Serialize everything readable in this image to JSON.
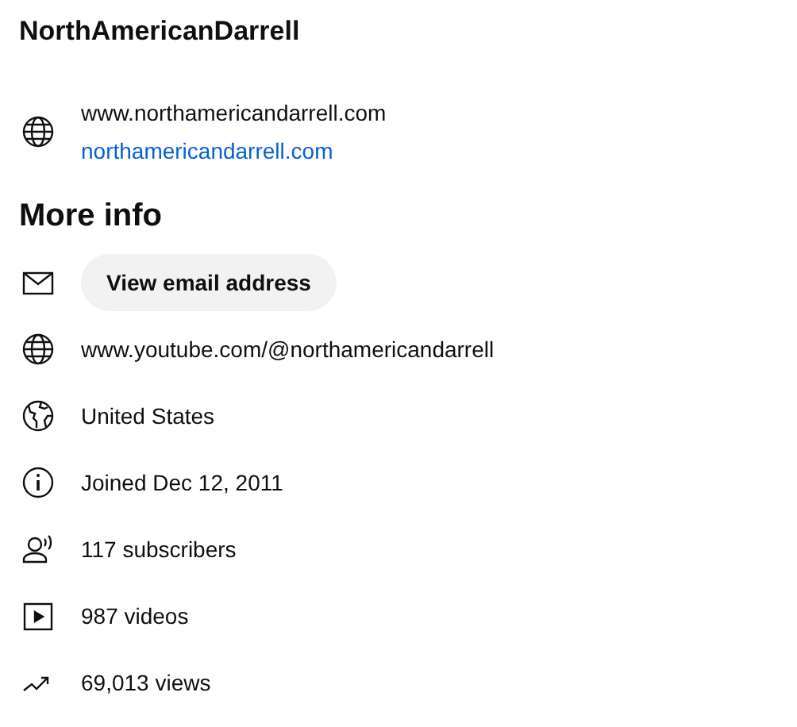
{
  "channel_name": "NorthAmericanDarrell",
  "link": {
    "title": "www.northamericandarrell.com",
    "url": "northamericandarrell.com"
  },
  "more_info": {
    "heading": "More info",
    "items": [
      {
        "kind": "email",
        "label": "View email address"
      },
      {
        "kind": "website",
        "label": "www.youtube.com/@northamericandarrell"
      },
      {
        "kind": "country",
        "label": "United States"
      },
      {
        "kind": "joined",
        "label": "Joined Dec 12, 2011"
      },
      {
        "kind": "subscribers",
        "label": "117 subscribers"
      },
      {
        "kind": "videos",
        "label": "987 videos"
      },
      {
        "kind": "views",
        "label": "69,013 views"
      }
    ]
  }
}
